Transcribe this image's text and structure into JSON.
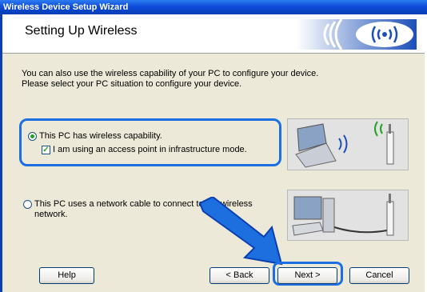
{
  "window": {
    "title": "Wireless Device Setup Wizard"
  },
  "header": {
    "title": "Setting Up Wireless",
    "logo_icon": "wireless-signal-icon"
  },
  "intro": {
    "line1": "You can also use the wireless capability of your PC to configure your device.",
    "line2": "Please select your PC situation to configure your device."
  },
  "options": {
    "wireless_pc": {
      "label": "This PC has wireless capability.",
      "selected": true
    },
    "access_point": {
      "label": "I am using an access point in infrastructure mode.",
      "checked": true
    },
    "network_cable": {
      "line1": "This PC uses a network cable to connect to the wireless",
      "line2": "network.",
      "selected": false
    }
  },
  "buttons": {
    "help": "Help",
    "back": "< Back",
    "next": "Next >",
    "cancel": "Cancel"
  },
  "colors": {
    "highlight": "#1b6fe0",
    "titlebar": "#0b49d6",
    "arrow": "#1d6fe0"
  }
}
